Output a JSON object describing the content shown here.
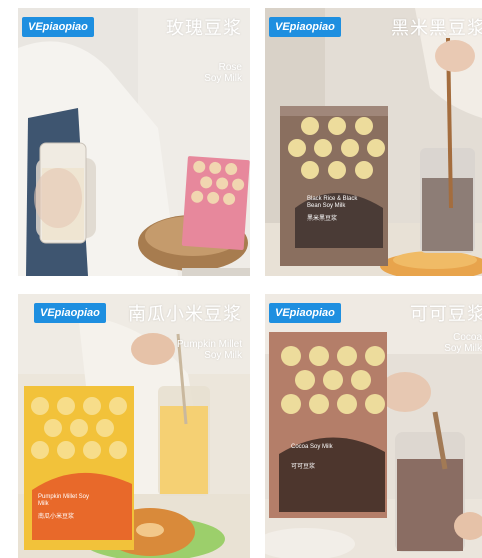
{
  "brand": "VEpiaopiao",
  "panels": [
    {
      "id": "rose",
      "cn": "玫瑰豆浆",
      "en1": "Rose",
      "en2": "Soy Milk",
      "box_en": "",
      "box_cn": ""
    },
    {
      "id": "black-rice",
      "cn": "黑米黑豆浆",
      "en1": "",
      "en2": "",
      "box_en": "Black Rice & Black Bean Soy Milk",
      "box_cn": "黑米黑豆浆"
    },
    {
      "id": "pumpkin",
      "cn": "南瓜小米豆浆",
      "en1": "Pumpkin Millet",
      "en2": "Soy Milk",
      "box_en": "Pumpkin Millet Soy Milk",
      "box_cn": "南瓜小米豆浆"
    },
    {
      "id": "cocoa",
      "cn": "可可豆浆",
      "en1": "Cocoa",
      "en2": "Soy Milk",
      "box_en": "Cocoa Soy Milk",
      "box_cn": "可可豆浆"
    }
  ],
  "colors": {
    "badge": "#1e8fe0",
    "rose_box": "#e7889c",
    "brown_box": "#8a6f5f",
    "yellow_box": "#f2c23a",
    "orange_panel": "#e8692a",
    "cocoa_box": "#b47e69"
  }
}
